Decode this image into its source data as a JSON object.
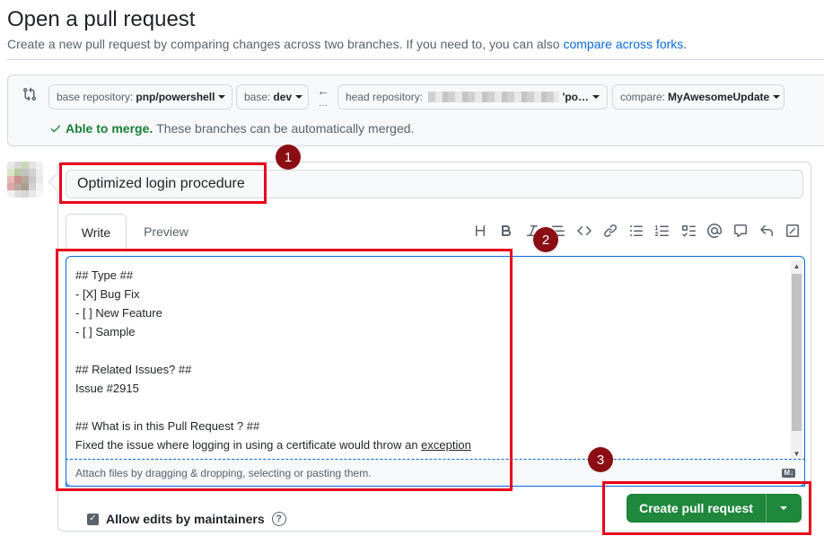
{
  "page": {
    "title": "Open a pull request",
    "subtitle_prefix": "Create a new pull request by comparing changes across two branches. If you need to, you can also ",
    "subtitle_link": "compare across forks",
    "subtitle_suffix": "."
  },
  "compare": {
    "base_repo_label": "base repository:",
    "base_repo_value": "pnp/powershell",
    "base_label": "base:",
    "base_value": "dev",
    "arrow": "←",
    "head_repo_label": "head repository:",
    "head_repo_value": "'po…",
    "compare_label": "compare:",
    "compare_value": "MyAwesomeUpdate",
    "merge_status_ok": "Able to merge.",
    "merge_status_text": "These branches can be automatically merged."
  },
  "form": {
    "title_value": "Optimized login procedure",
    "tabs": [
      {
        "label": "Write",
        "active": true
      },
      {
        "label": "Preview",
        "active": false
      }
    ],
    "toolbar": [
      "heading-icon",
      "bold-icon",
      "italic-icon",
      "quote-icon",
      "code-icon",
      "link-icon",
      "unordered-list-icon",
      "ordered-list-icon",
      "task-list-icon",
      "mention-icon",
      "reference-icon",
      "undo-icon",
      "fullscreen-icon"
    ],
    "body_lines": [
      "## Type ##",
      "- [X] Bug Fix",
      "- [ ] New Feature",
      "- [ ] Sample",
      "",
      "## Related Issues? ##",
      "Issue #2915",
      "",
      "## What is in this Pull Request ? ##"
    ],
    "body_last_prefix": "Fixed the issue where logging in using a certificate would throw an ",
    "body_last_underlined": "exception",
    "attach_hint": "Attach files by dragging & dropping, selecting or pasting them.",
    "markdown_badge": "M↓",
    "allow_edits_label": "Allow edits by maintainers",
    "allow_edits_checked": true,
    "create_button_label": "Create pull request"
  },
  "annotations": {
    "markers": [
      "1",
      "2",
      "3"
    ],
    "highlight_color": "#e8001c",
    "marker_color": "#8b0e14"
  },
  "colors": {
    "primary_button": "#1f883d",
    "link": "#0969da",
    "success": "#1a7f37"
  }
}
